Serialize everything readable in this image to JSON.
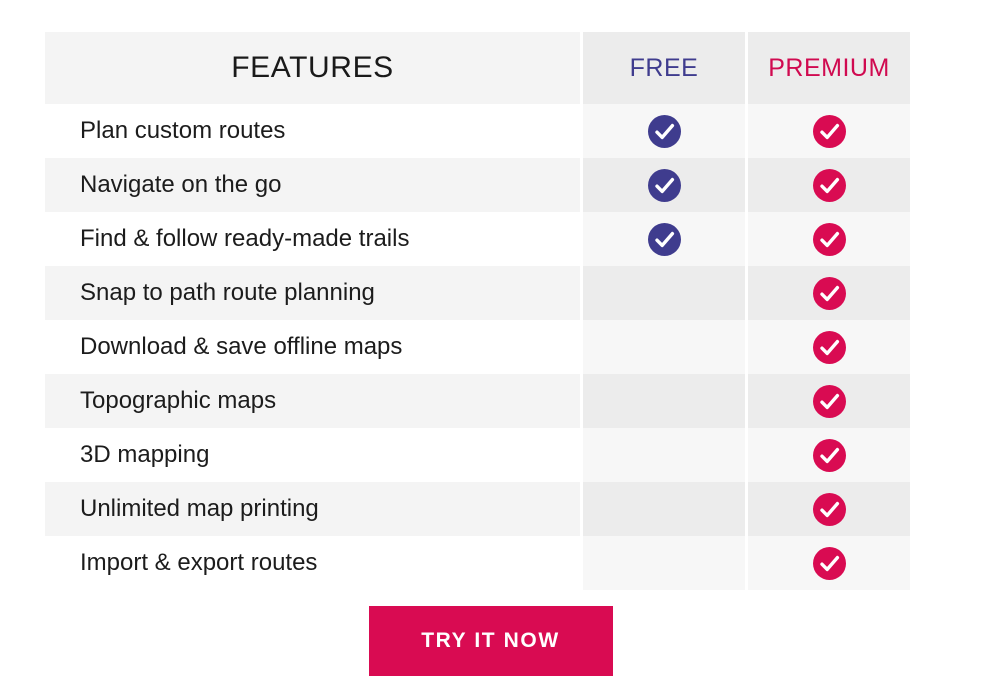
{
  "table": {
    "headers": {
      "features": "FEATURES",
      "free": "FREE",
      "premium": "PREMIUM"
    },
    "colors": {
      "free_accent": "#3f3c8e",
      "premium_accent": "#d90b52",
      "premium_header_text": "#d00a50",
      "row_light": "#ffffff",
      "row_shade": "#f4f4f4",
      "header_shade": "#ececec"
    },
    "rows": [
      {
        "feature": "Plan custom routes",
        "free": true,
        "premium": true
      },
      {
        "feature": "Navigate on the go",
        "free": true,
        "premium": true
      },
      {
        "feature": "Find & follow ready-made trails",
        "free": true,
        "premium": true
      },
      {
        "feature": "Snap to path route planning",
        "free": false,
        "premium": true
      },
      {
        "feature": "Download & save offline maps",
        "free": false,
        "premium": true
      },
      {
        "feature": "Topographic maps",
        "free": false,
        "premium": true
      },
      {
        "feature": "3D mapping",
        "free": false,
        "premium": true
      },
      {
        "feature": "Unlimited map printing",
        "free": false,
        "premium": true
      },
      {
        "feature": "Import & export routes",
        "free": false,
        "premium": true
      }
    ]
  },
  "cta": {
    "label": "TRY IT NOW"
  },
  "icons": {
    "check": "check-circle-icon"
  }
}
